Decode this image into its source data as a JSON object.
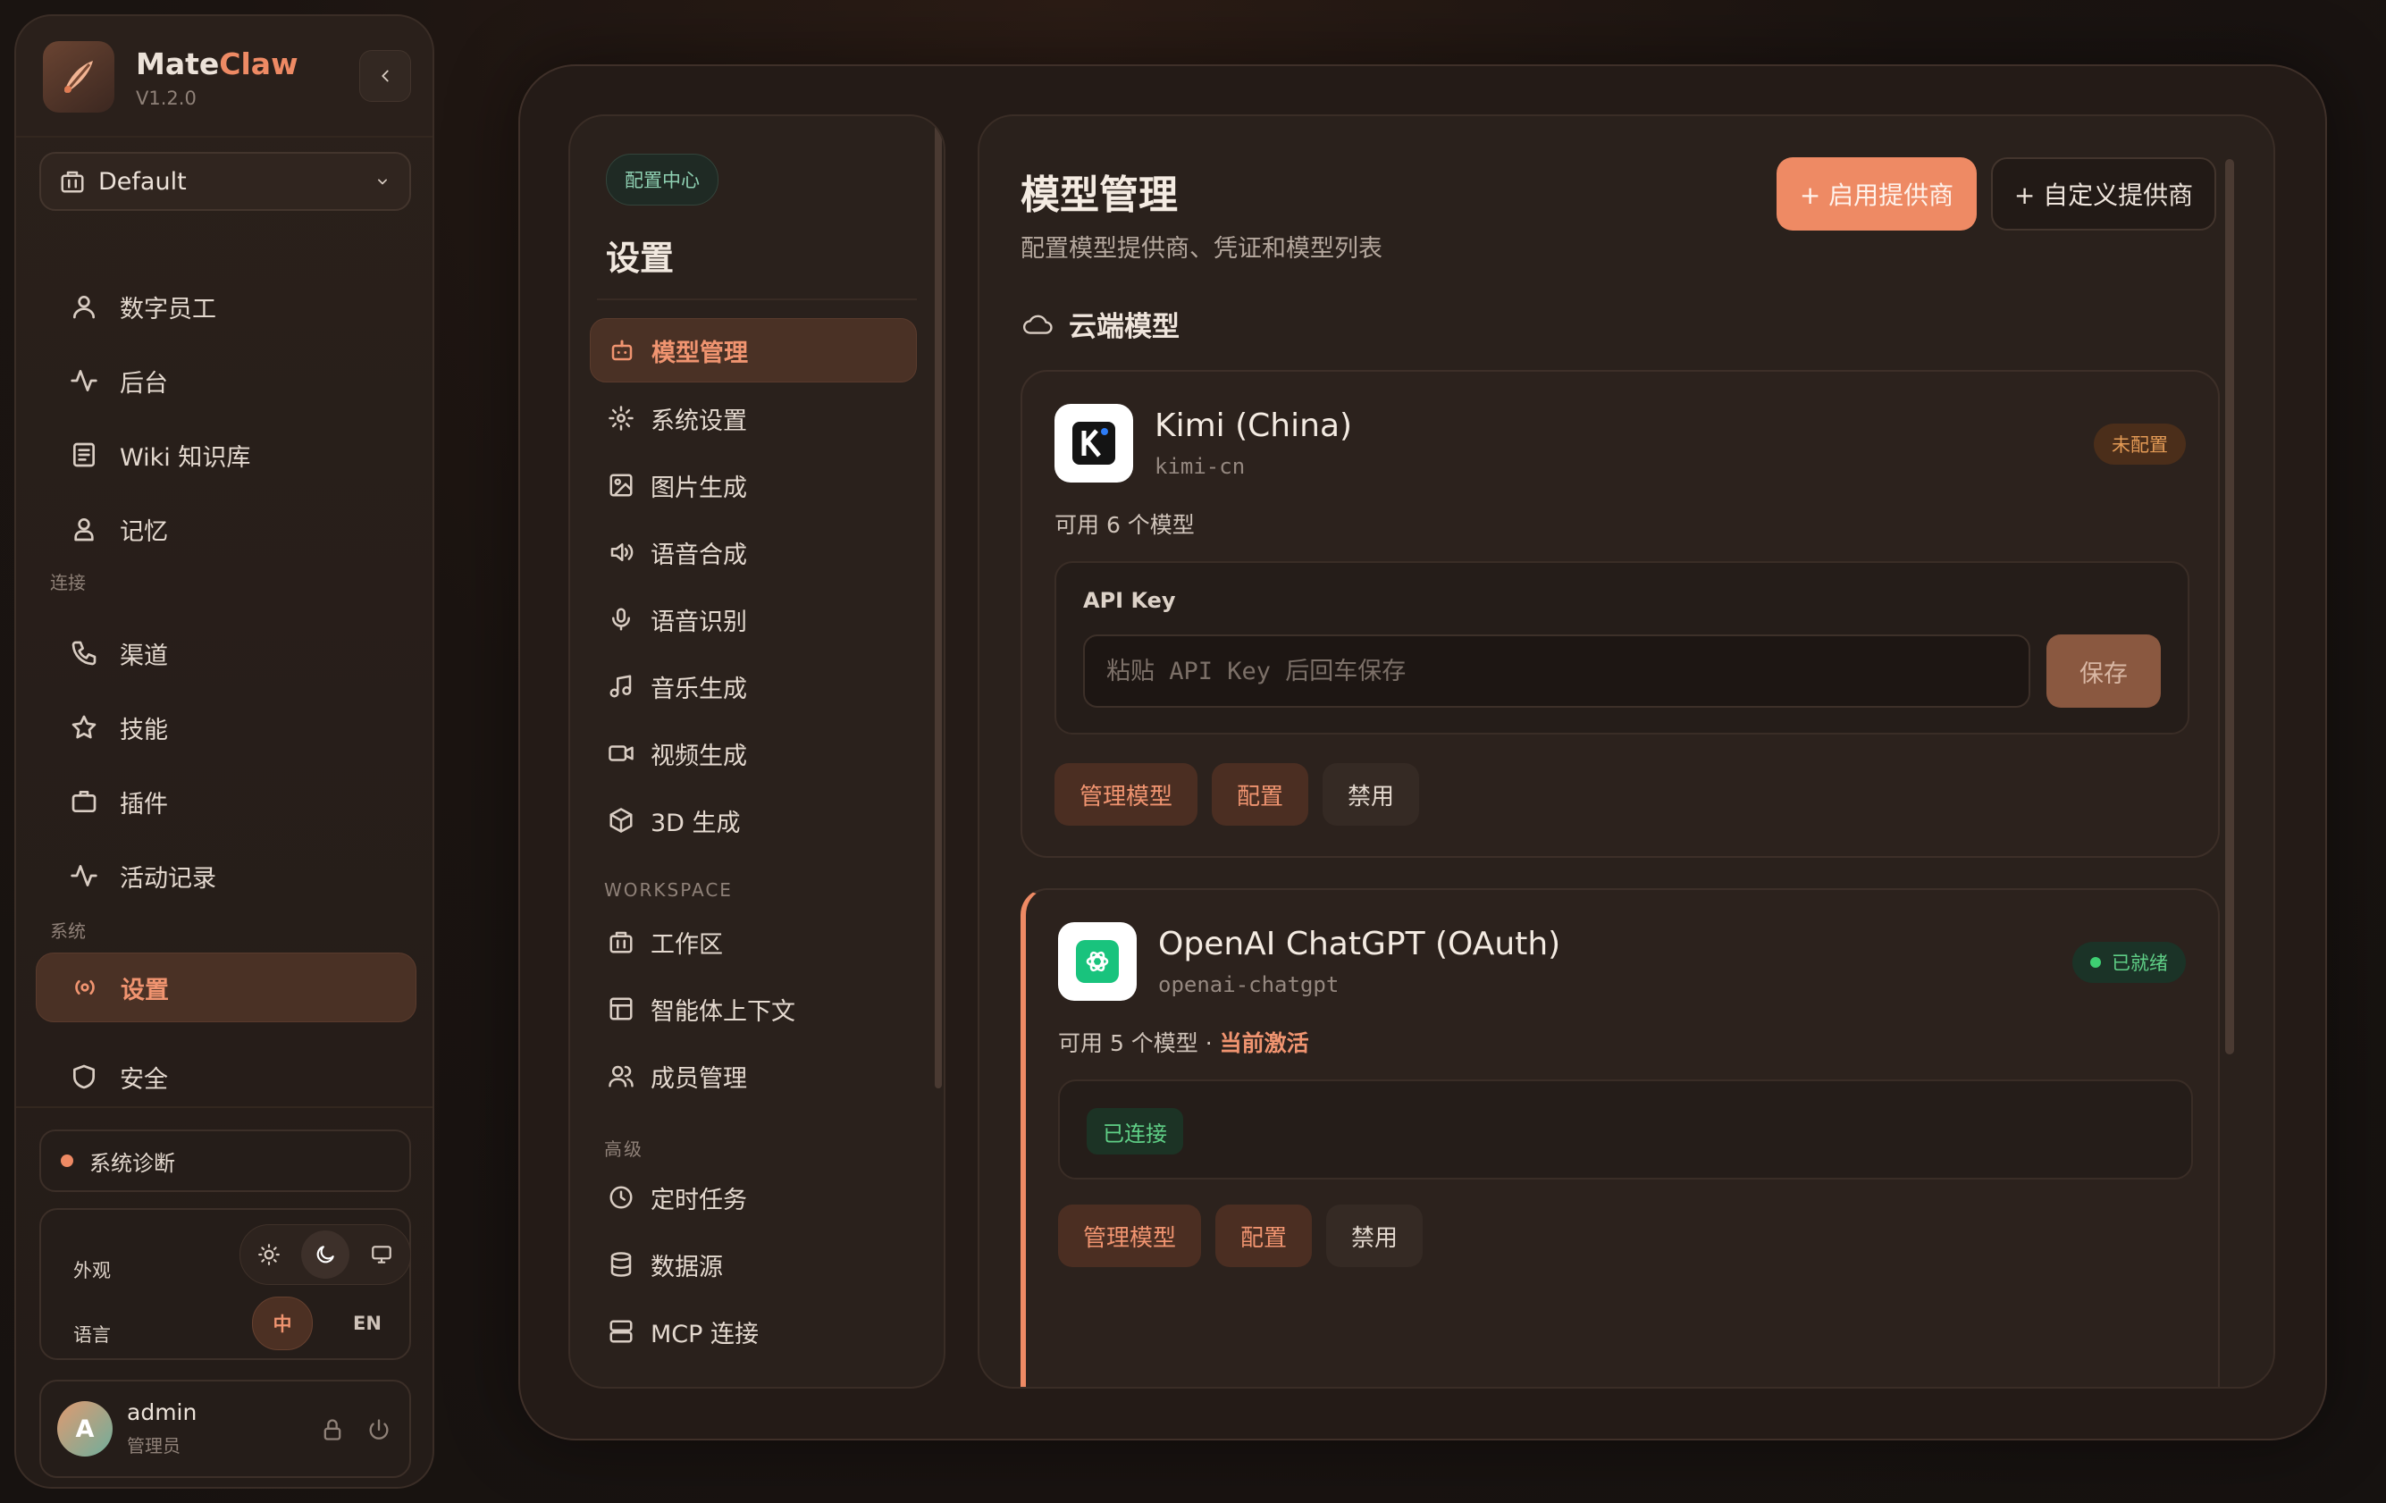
{
  "app": {
    "name_main": "Mate",
    "name_accent": "Claw",
    "version": "V1.2.0"
  },
  "workspace": {
    "label": "Default"
  },
  "sidebar": {
    "items": [
      {
        "label": "数字员工"
      },
      {
        "label": "后台"
      },
      {
        "label": "Wiki 知识库"
      },
      {
        "label": "记忆"
      }
    ],
    "section_connect": "连接",
    "connect_items": [
      {
        "label": "渠道"
      },
      {
        "label": "技能"
      },
      {
        "label": "插件"
      },
      {
        "label": "活动记录"
      }
    ],
    "section_system": "系统",
    "system_items": [
      {
        "label": "设置"
      },
      {
        "label": "安全"
      }
    ],
    "diagnostics": "系统诊断",
    "appearance_label": "外观",
    "language_label": "语言",
    "lang_zh": "中",
    "lang_en": "EN",
    "user": {
      "initial": "A",
      "name": "admin",
      "role": "管理员"
    }
  },
  "settings_nav": {
    "pill": "配置中心",
    "title": "设置",
    "items": [
      {
        "label": "模型管理"
      },
      {
        "label": "系统设置"
      },
      {
        "label": "图片生成"
      },
      {
        "label": "语音合成"
      },
      {
        "label": "语音识别"
      },
      {
        "label": "音乐生成"
      },
      {
        "label": "视频生成"
      },
      {
        "label": "3D 生成"
      }
    ],
    "section_workspace": "WORKSPACE",
    "workspace_items": [
      {
        "label": "工作区"
      },
      {
        "label": "智能体上下文"
      },
      {
        "label": "成员管理"
      }
    ],
    "section_advanced": "高级",
    "advanced_items": [
      {
        "label": "定时任务"
      },
      {
        "label": "数据源"
      },
      {
        "label": "MCP 连接"
      }
    ]
  },
  "main": {
    "title": "模型管理",
    "subtitle": "配置模型提供商、凭证和模型列表",
    "enable_provider": "+ 启用提供商",
    "custom_provider": "+ 自定义提供商",
    "section_cloud": "云端模型",
    "providers": [
      {
        "name": "Kimi (China)",
        "id": "kimi-cn",
        "status": "未配置",
        "available": "可用 6 个模型",
        "api_key_label": "API Key",
        "api_key_placeholder": "粘贴 API Key 后回车保存",
        "save": "保存",
        "manage": "管理模型",
        "config": "配置",
        "disable": "禁用"
      },
      {
        "name": "OpenAI ChatGPT (OAuth)",
        "id": "openai-chatgpt",
        "status": "已就绪",
        "available": "可用 5 个模型 · ",
        "active": "当前激活",
        "connected": "已连接",
        "manage": "管理模型",
        "config": "配置",
        "disable": "禁用"
      }
    ]
  },
  "colors": {
    "accent": "#ee8a64",
    "bg": "#1b1411",
    "ok": "#5fcf86",
    "warn": "#e39a55"
  }
}
